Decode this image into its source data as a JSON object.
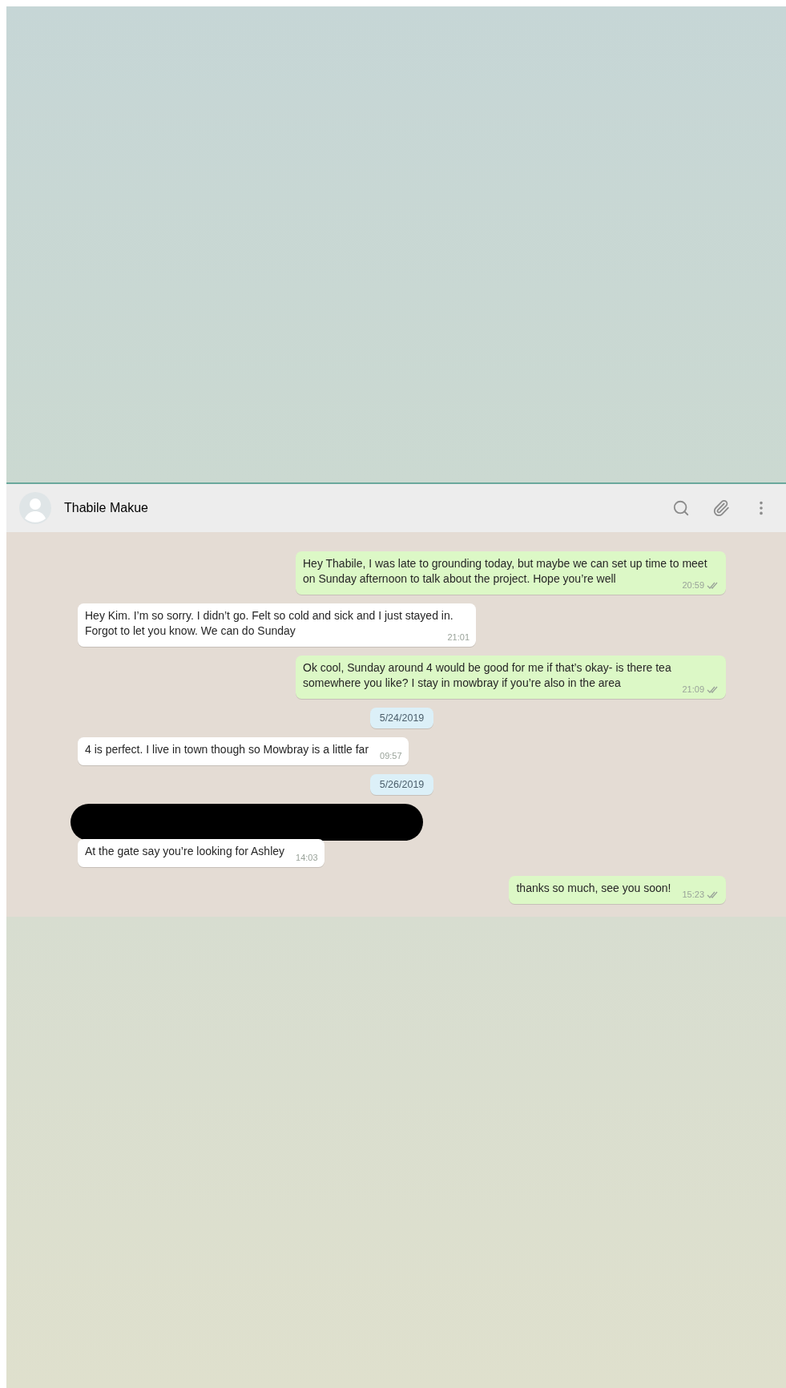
{
  "chat": {
    "contact": {
      "name": "Thabile Makue"
    },
    "messages": [
      {
        "kind": "outgoing",
        "text": "Hey Thabile, I was late to grounding today, but maybe we can set up time to meet on Sunday afternoon to talk about the project. Hope you’re well",
        "time": "20:59",
        "read": false
      },
      {
        "kind": "incoming",
        "text": "Hey Kim. I’m so sorry. I didn’t go. Felt so cold and sick and I just stayed in. Forgot to let you know. We can do Sunday",
        "time": "21:01",
        "redacted": false
      },
      {
        "kind": "outgoing",
        "text": "Ok cool, Sunday around 4 would be good for me if that’s okay- is there tea somewhere you like? I stay in mowbray if you’re also in the area",
        "time": "21:09",
        "read": false
      },
      {
        "kind": "date",
        "text": "5/24/2019"
      },
      {
        "kind": "incoming",
        "text": "4 is perfect. I live in town though so Mowbray is a little far",
        "time": "09:57",
        "redacted": false
      },
      {
        "kind": "date",
        "text": "5/26/2019"
      },
      {
        "kind": "incoming",
        "text": "At the gate say you’re looking for Ashley",
        "time": "14:03",
        "redacted": true
      },
      {
        "kind": "outgoing",
        "text": "thanks so much, see you soon!",
        "time": "15:23",
        "read": false
      }
    ]
  }
}
